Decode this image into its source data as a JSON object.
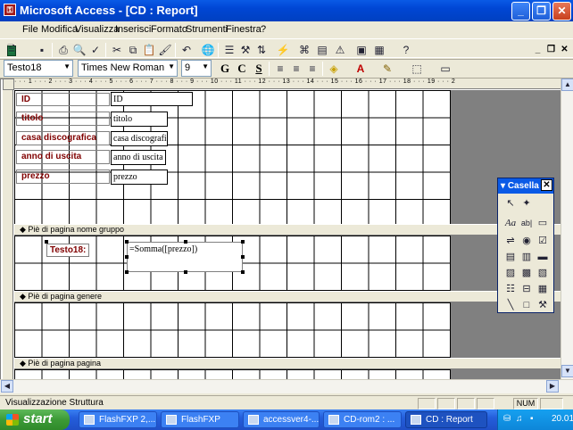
{
  "window": {
    "title": "Microsoft Access - [CD : Report]",
    "app_icon": "access-key-icon"
  },
  "menu": [
    "File",
    "Modifica",
    "Visualizza",
    "Inserisci",
    "Formato",
    "Strumenti",
    "Finestra",
    "?"
  ],
  "format_bar": {
    "control_combo": "Testo18",
    "font_combo": "Times New Roman",
    "size_combo": "9",
    "bold": "G",
    "italic": "C",
    "underline": "S"
  },
  "ruler": {
    "ticks": "· · · 1 · · · 2 · · · 3 · · · 4 · · · 5 · · · 6 · · · 7 · · · 8 · · · 9 · · · 10 · · · 11 · · · 12 · · · 13 · · · 14 · · · 15 · · · 16 · · · 17 · · · 18 · · · 19 · · · 2"
  },
  "detail": {
    "fields": [
      {
        "label": "ID",
        "value": "ID"
      },
      {
        "label": "titolo",
        "value": "titolo"
      },
      {
        "label": "casa discografica",
        "value": "casa discografic"
      },
      {
        "label": "anno di uscita",
        "value": "anno di uscita"
      },
      {
        "label": "prezzo",
        "value": "prezzo"
      }
    ]
  },
  "sections": {
    "group_footer": "Piè di pagina nome gruppo",
    "report_footer": "Piè di pagina genere",
    "page_footer": "Piè di pagina pagina"
  },
  "group_footer_controls": {
    "label": "Testo18:",
    "expression": "=Somma([prezzo])"
  },
  "toolbox": {
    "title": "Casella"
  },
  "status": {
    "text": "Visualizzazione Struttura",
    "num": "NUM"
  },
  "taskbar": {
    "start": "start",
    "tasks": [
      "FlashFXP 2,...",
      "FlashFXP",
      "accessver4-...",
      "CD-rom2 : ...",
      "CD : Report"
    ],
    "clock": "20.01"
  },
  "colors": {
    "title_blue": "#0a5ae6",
    "label_red": "#800000",
    "taskbar_blue": "#245edb"
  }
}
